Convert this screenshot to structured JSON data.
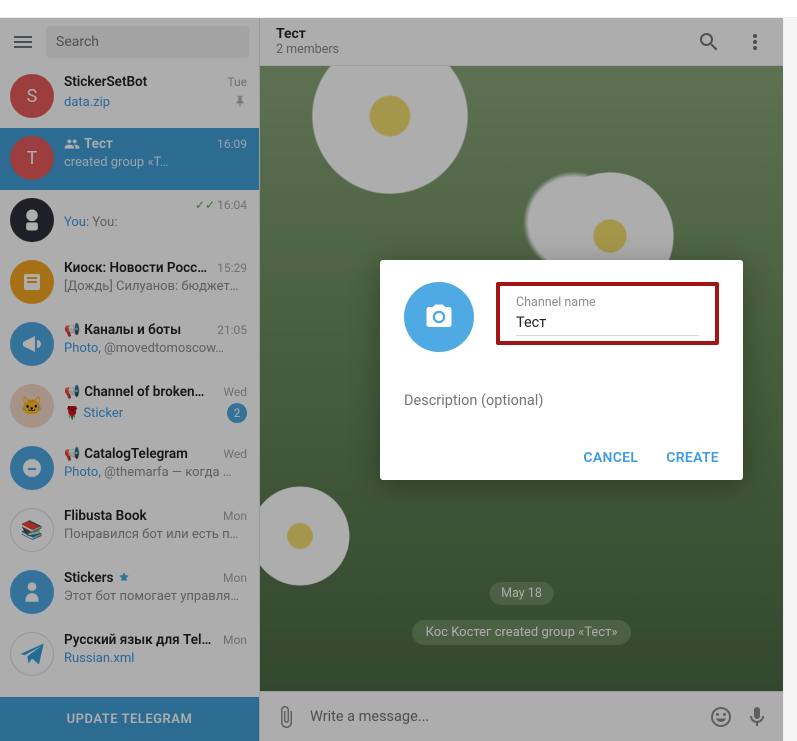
{
  "sidebar": {
    "search_placeholder": "Search",
    "update_label": "UPDATE TELEGRAM"
  },
  "chats": [
    {
      "initial": "S",
      "name": "StickerSetBot",
      "time": "Tue",
      "msg": "data.zip",
      "msg_link": true,
      "pinned": true
    },
    {
      "initial": "T",
      "name": "Тест",
      "time": "16:09",
      "msg": "created group «T…",
      "group_icon": true,
      "selected": true
    },
    {
      "initial": "",
      "name": "",
      "time": "16:04",
      "msg": "You:",
      "you_prefix": true,
      "check": true
    },
    {
      "initial": "",
      "name": "Киоск: Новости Росс…",
      "time": "15:29",
      "msg": "[Дождь]  Силуанов: бюджет…"
    },
    {
      "initial": "",
      "name": "Каналы и боты",
      "time": "21:05",
      "msg_prefix": "Photo, ",
      "msg": "@movedtomoscow…",
      "megaphone": true
    },
    {
      "initial": "",
      "name": "Channel of broken…",
      "time": "Wed",
      "msg_prefix": "🌹 ",
      "msg": "Sticker",
      "msg_link": true,
      "badge": "2",
      "megaphone": true
    },
    {
      "initial": "",
      "name": "CatalogTelegram",
      "time": "Wed",
      "msg_prefix": "Photo, ",
      "msg": "@themarfa — когда …",
      "megaphone": true
    },
    {
      "initial": "",
      "name": "Flibusta Book",
      "time": "Mon",
      "msg": "Понравился бот или есть п…"
    },
    {
      "initial": "",
      "name": "Stickers",
      "time": "Mon",
      "msg": "Этот бот помогает управля…",
      "verified": true
    },
    {
      "initial": "",
      "name": "Русский язык для Tel…",
      "time": "Mon",
      "msg": "Russian.xml",
      "msg_link": true
    }
  ],
  "header": {
    "title": "Тест",
    "subtitle": "2 members"
  },
  "chat": {
    "date_pill": "May 18",
    "system_msg": "Кос Koстег created group «Тест»"
  },
  "composer": {
    "placeholder": "Write a message..."
  },
  "modal": {
    "field_label": "Channel name",
    "field_value": "Тест",
    "desc_placeholder": "Description (optional)",
    "cancel": "CANCEL",
    "create": "CREATE"
  }
}
